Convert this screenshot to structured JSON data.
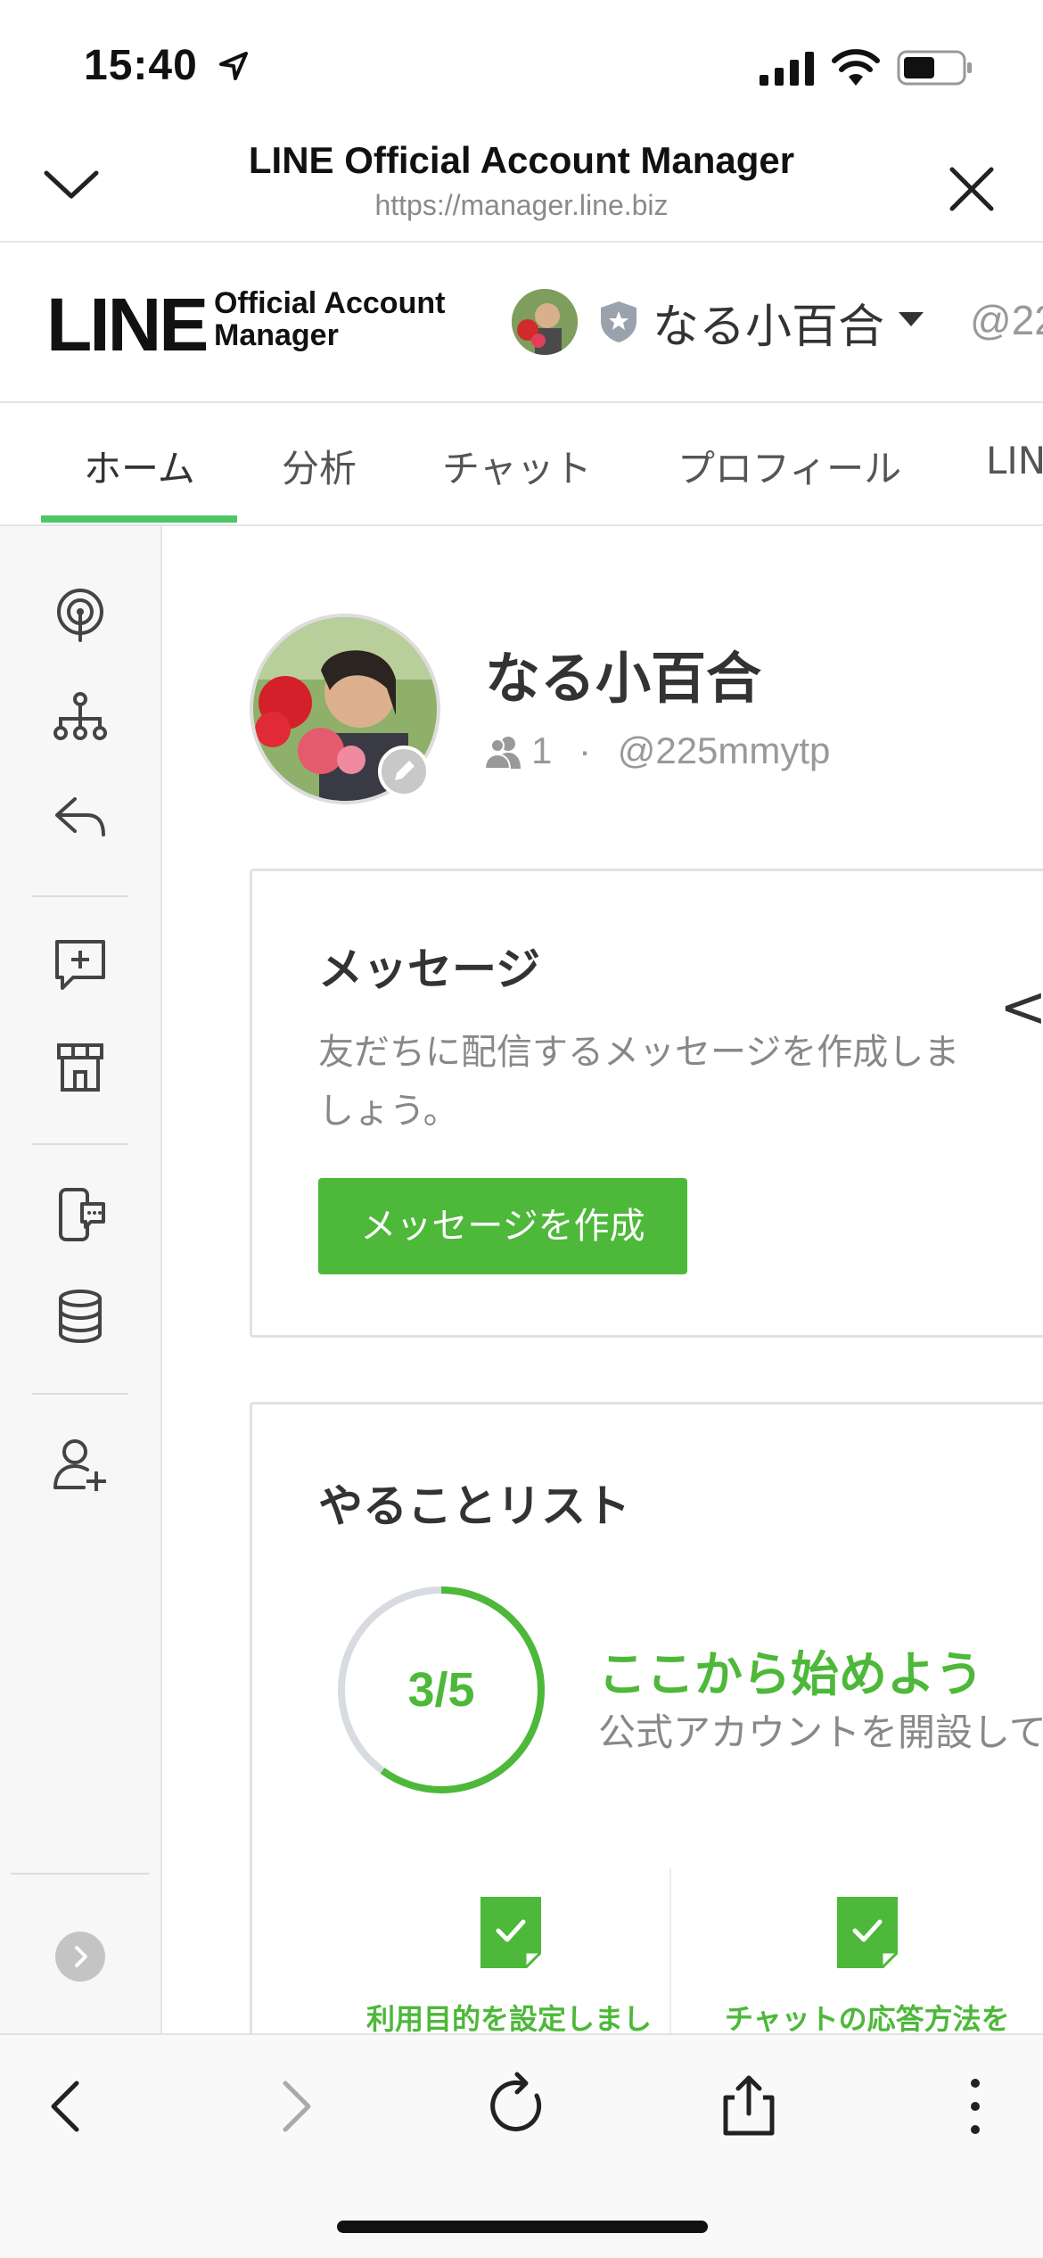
{
  "status_bar": {
    "time": "15:40"
  },
  "browser": {
    "title": "LINE Official Account Manager",
    "url": "https://manager.line.biz"
  },
  "app_header": {
    "logo_main": "LINE",
    "logo_sub_line1": "Official Account",
    "logo_sub_line2": "Manager",
    "account_name": "なる小百合",
    "account_id_partial": "@22"
  },
  "tabs": [
    {
      "label": "ホーム",
      "active": true
    },
    {
      "label": "分析",
      "active": false
    },
    {
      "label": "チャット",
      "active": false
    },
    {
      "label": "プロフィール",
      "active": false
    },
    {
      "label": "LIN",
      "active": false
    }
  ],
  "sidebar": {
    "icons": [
      "broadcast-icon",
      "hierarchy-icon",
      "reply-icon",
      "add-message-icon",
      "shop-icon",
      "phone-chat-icon",
      "database-icon",
      "add-friend-icon"
    ]
  },
  "profile": {
    "name": "なる小百合",
    "friends_count": "1",
    "separator": "·",
    "account_id": "@225mmytp"
  },
  "message_card": {
    "title": "メッセージ",
    "description": "友だちに配信するメッセージを作成しましょう。",
    "button_label": "メッセージを作成",
    "peek_arrow": "<"
  },
  "todo_card": {
    "title": "やることリスト",
    "progress_label": "3/5",
    "progress_fraction": 0.6,
    "heading": "ここから始めよう",
    "subtext": "公式アカウントを開設して",
    "items": [
      {
        "label": "利用目的を設定しまし",
        "done": true
      },
      {
        "label": "チャットの応答方法を",
        "done": true
      }
    ]
  },
  "colors": {
    "accent_green": "#4db839",
    "tab_underline": "#4cc764"
  }
}
